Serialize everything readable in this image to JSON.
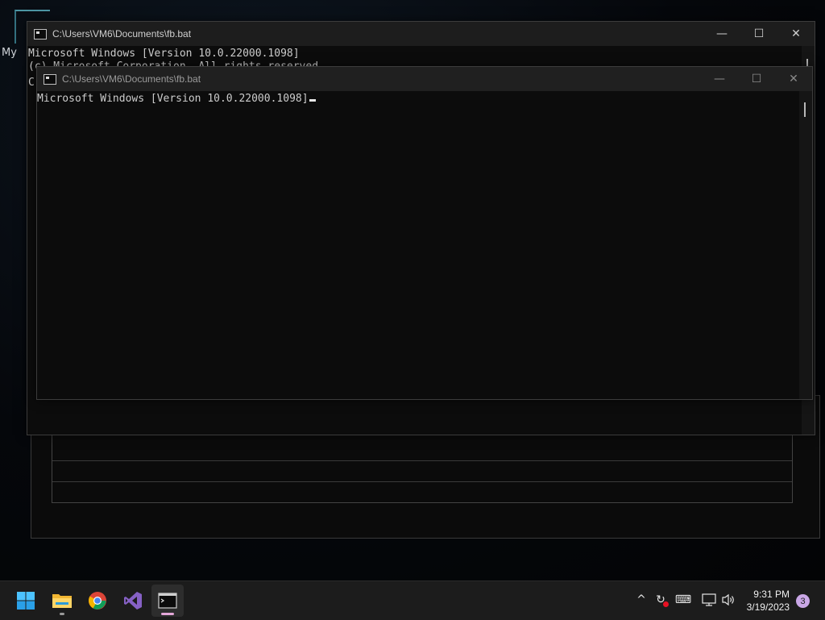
{
  "desktop": {
    "partial_label": "My"
  },
  "back_window": {
    "title": "C:\\Users\\VM6\\Documents\\fb.bat",
    "lines": [
      "Microsoft Windows [Version 10.0.22000.1098]",
      "(c) Microsoft Corporation. All rights reserved.",
      "C"
    ]
  },
  "front_window": {
    "title": "C:\\Users\\VM6\\Documents\\fb.bat",
    "lines": [
      "Microsoft Windows [Version 10.0.22000.1098]"
    ]
  },
  "window_controls": {
    "minimize": "—",
    "maximize": "☐",
    "close": "✕"
  },
  "taskbar": {
    "apps": [
      {
        "name": "start-icon"
      },
      {
        "name": "file-explorer-icon"
      },
      {
        "name": "chrome-icon"
      },
      {
        "name": "visual-studio-icon"
      },
      {
        "name": "terminal-icon",
        "active": true
      }
    ],
    "tray": {
      "chevron": "^",
      "sync": "↻",
      "keyboard": "⌨",
      "network": "🖵",
      "volume": "🔊"
    },
    "clock": {
      "time": "9:31 PM",
      "date": "3/19/2023"
    },
    "notifications": "3"
  }
}
